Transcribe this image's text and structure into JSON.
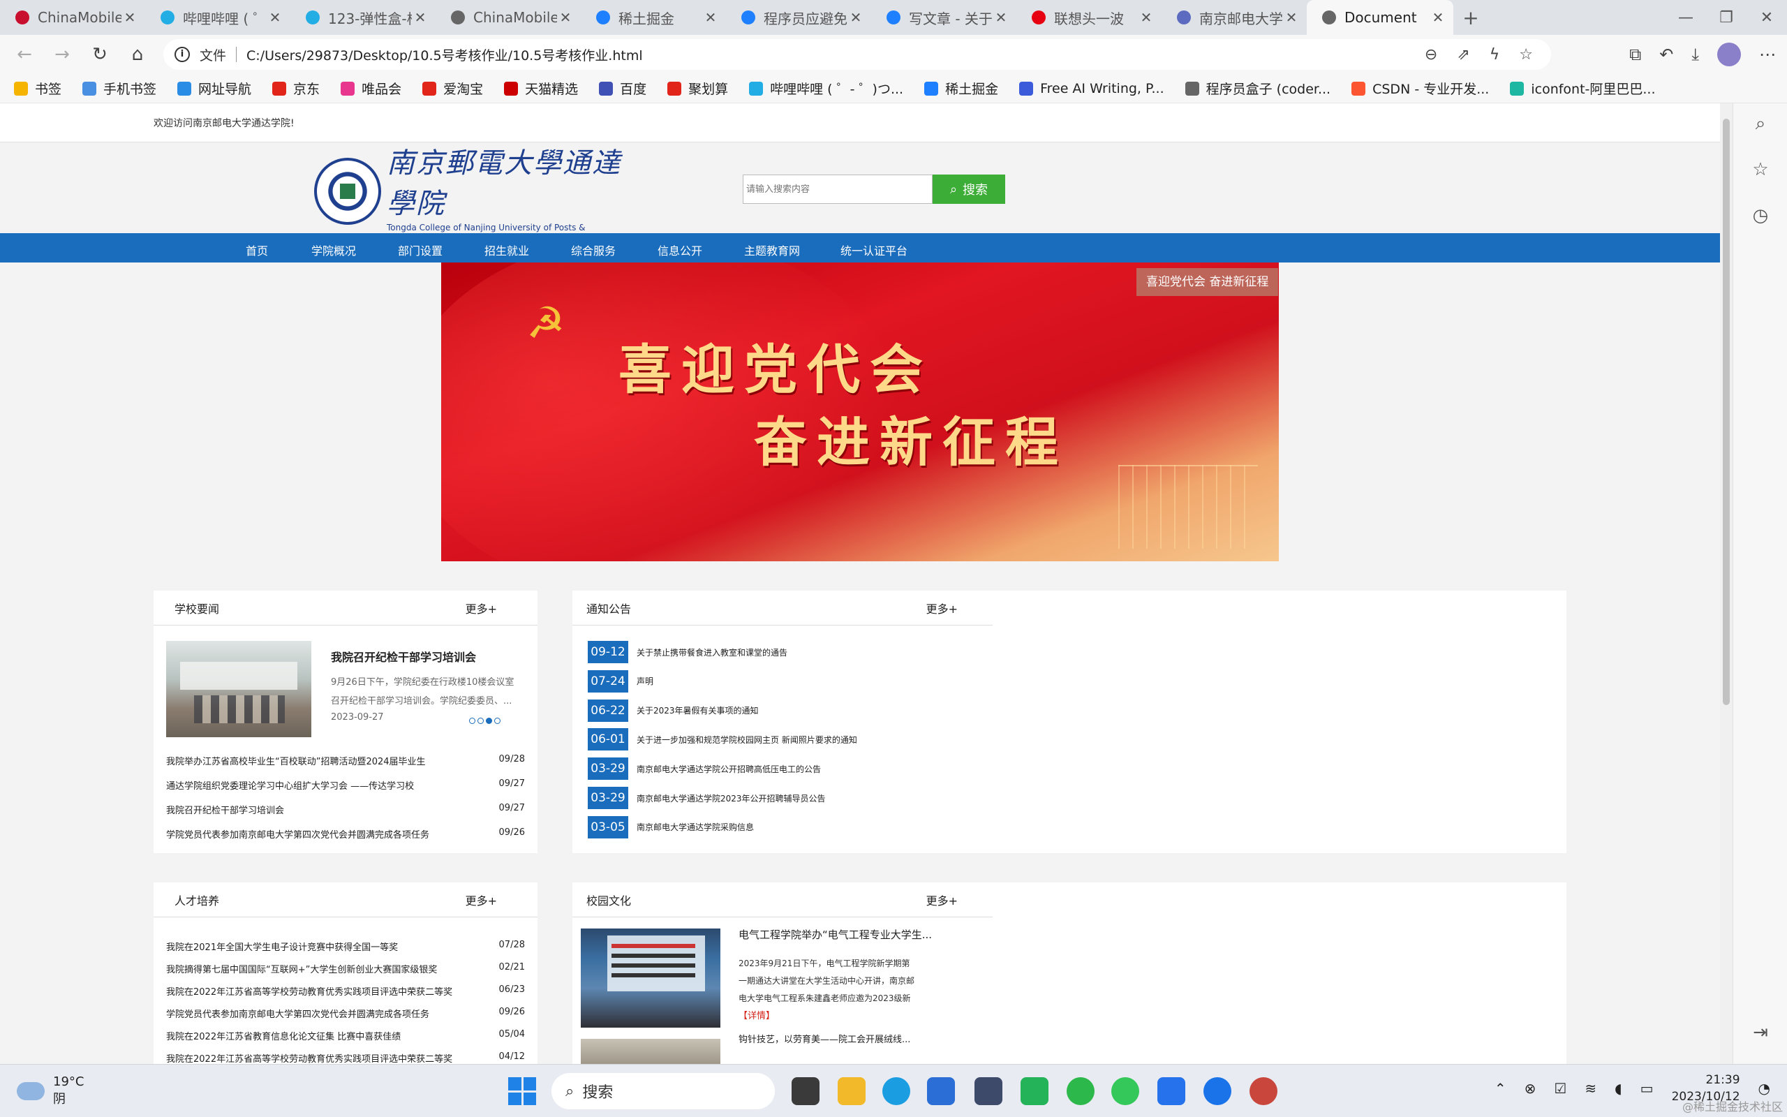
{
  "tabs": [
    {
      "label": "ChinaMobile",
      "color": "#c8102e"
    },
    {
      "label": "哔哩哔哩 ( ゜- ゜",
      "color": "#23ade5"
    },
    {
      "label": "123-弹性盒-核",
      "color": "#23ade5"
    },
    {
      "label": "ChinaMobile",
      "color": "#666666"
    },
    {
      "label": "稀土掘金",
      "color": "#1e80ff"
    },
    {
      "label": "程序员应避免的",
      "color": "#1e80ff"
    },
    {
      "label": "写文章 - 关于",
      "color": "#1e80ff"
    },
    {
      "label": "联想头一波",
      "color": "#e60012"
    },
    {
      "label": "南京邮电大学",
      "color": "#5c6bc0"
    },
    {
      "label": "Document",
      "color": "#666666",
      "active": true
    }
  ],
  "address": {
    "file_label": "文件",
    "url": "C:/Users/29873/Desktop/10.5号考核作业/10.5号考核作业.html"
  },
  "bookmarks": [
    {
      "label": "书签",
      "color": "#f4b400"
    },
    {
      "label": "手机书签",
      "color": "#4a90e2"
    },
    {
      "label": "网址导航",
      "color": "#2b8ce6"
    },
    {
      "label": "京东",
      "color": "#e1251b"
    },
    {
      "label": "唯品会",
      "color": "#e8368f"
    },
    {
      "label": "爱淘宝",
      "color": "#e1251b"
    },
    {
      "label": "天猫精选",
      "color": "#cc0000"
    },
    {
      "label": "百度",
      "color": "#3f51b5"
    },
    {
      "label": "聚划算",
      "color": "#e1251b"
    },
    {
      "label": "哔哩哔哩 ( ゜- ゜)つ...",
      "color": "#23ade5"
    },
    {
      "label": "稀土掘金",
      "color": "#1e80ff"
    },
    {
      "label": "Free AI Writing, P...",
      "color": "#3b5bdb"
    },
    {
      "label": "程序员盒子 (coder...",
      "color": "#666666"
    },
    {
      "label": "CSDN - 专业开发...",
      "color": "#fc5531"
    },
    {
      "label": "iconfont-阿里巴巴...",
      "color": "#1db7a2"
    }
  ],
  "site": {
    "welcome": "欢迎访问南京邮电大学通达学院!",
    "logo_cn": "南京郵電大學通達學院",
    "logo_en": "Tongda College of Nanjing University of Posts & Telecommunications",
    "search_placeholder": "请输入搜索内容",
    "search_button": "搜索",
    "nav": [
      "首页",
      "学院概况",
      "部门设置",
      "招生就业",
      "综合服务",
      "信息公开",
      "主题教育网",
      "统一认证平台"
    ],
    "banner_caption": "喜迎党代会 奋进新征程",
    "banner_line1": "喜迎党代会",
    "banner_line2": "奋进新征程"
  },
  "school_news": {
    "title": "学校要闻",
    "more": "更多+",
    "featured": {
      "headline": "我院召开纪检干部学习培训会",
      "summary_1": "9月26日下午，学院纪委在行政楼10楼会议室",
      "summary_2": "召开纪检干部学习培训会。学院纪委委员、...",
      "date": "2023-09-27"
    },
    "items": [
      {
        "title": "我院举办江苏省高校毕业生“百校联动”招聘活动暨2024届毕业生",
        "date": "09/28"
      },
      {
        "title": "通达学院组织党委理论学习中心组扩大学习会 ——传达学习校",
        "date": "09/27"
      },
      {
        "title": "我院召开纪检干部学习培训会",
        "date": "09/27"
      },
      {
        "title": "学院党员代表参加南京邮电大学第四次党代会并圆满完成各项任务",
        "date": "09/26"
      }
    ]
  },
  "notices": {
    "title": "通知公告",
    "more": "更多+",
    "items": [
      {
        "date": "09-12",
        "title": "关于禁止携带餐食进入教室和课堂的通告"
      },
      {
        "date": "07-24",
        "title": "声明"
      },
      {
        "date": "06-22",
        "title": "关于2023年暑假有关事项的通知"
      },
      {
        "date": "06-01",
        "title": "关于进一步加强和规范学院校园网主页 新闻照片要求的通知"
      },
      {
        "date": "03-29",
        "title": "南京邮电大学通达学院公开招聘高低压电工的公告"
      },
      {
        "date": "03-29",
        "title": "南京邮电大学通达学院2023年公开招聘辅导员公告"
      },
      {
        "date": "03-05",
        "title": "南京邮电大学通达学院采购信息"
      }
    ]
  },
  "talent": {
    "title": "人才培养",
    "more": "更多+",
    "items": [
      {
        "title": "我院在2021年全国大学生电子设计竞赛中获得全国一等奖",
        "date": "07/28"
      },
      {
        "title": "我院摘得第七届中国国际“互联网+”大学生创新创业大赛国家级银奖",
        "date": "02/21"
      },
      {
        "title": "我院在2022年江苏省高等学校劳动教育优秀实践项目评选中荣获二等奖",
        "date": "06/23"
      },
      {
        "title": "学院党员代表参加南京邮电大学第四次党代会并圆满完成各项任务",
        "date": "09/26"
      },
      {
        "title": "我院在2022年江苏省教育信息化论文征集 比赛中喜获佳绩",
        "date": "05/04"
      },
      {
        "title": "我院在2022年江苏省高等学校劳动教育优秀实践项目评选中荣获二等奖",
        "date": "04/12"
      }
    ]
  },
  "campus": {
    "title": "校园文化",
    "more": "更多+",
    "article1_title": "电气工程学院举办“电气工程专业大学生...",
    "article1_line1": "2023年9月21日下午，电气工程学院新学期第",
    "article1_line2": "一期通达大讲堂在大学生活动中心开讲，南京邮",
    "article1_line3": "电大学电气工程系朱建鑫老师应邀为2023级新",
    "article1_detail": "【详情】",
    "article2_title": "钩针技艺，以劳育美——院工会开展绒线..."
  },
  "taskbar": {
    "temp": "19°C",
    "weather": "阴",
    "search": "搜索",
    "time": "21:39",
    "date": "2023/10/12"
  },
  "watermark": "@稀土掘金技术社区"
}
